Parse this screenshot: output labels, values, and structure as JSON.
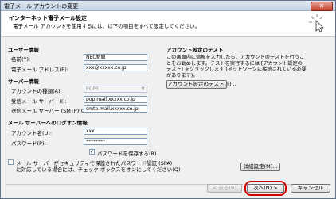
{
  "window": {
    "title": "電子メール アカウントの変更",
    "close_glyph": "✕"
  },
  "header": {
    "title": "インターネット電子メール設定",
    "subtitle": "電子メール アカウントを使用するには、以下の項目をすべて設定してください。"
  },
  "user_info": {
    "heading": "ユーザー情報",
    "name_label": "名前(Y):",
    "name_value": "NEC新聞",
    "email_label": "電子メール アドレス(E):",
    "email_value": "xxx@xxxxx.co.jp"
  },
  "server_info": {
    "heading": "サーバー情報",
    "account_type_label": "アカウントの種類(A):",
    "account_type_value": "POP3",
    "incoming_label": "受信メール サーバー(I):",
    "incoming_value": "pop.mail.xxxxx.co.jp",
    "outgoing_label": "送信メール サーバー (SMTP)(O):",
    "outgoing_value": "smtp.mail.xxxxx.co.jp"
  },
  "logon_info": {
    "heading": "メール サーバーへのログオン情報",
    "account_label": "アカウント名(U):",
    "account_value": "xxx",
    "password_label": "パスワード(P):",
    "password_value": "********",
    "remember_label": "パスワードを保存する(R)",
    "remember_checked": "✓",
    "spa_label_line1": "メール サーバーがセキュリティで保護されたパスワード認証 (SPA)",
    "spa_label_line2": "に対応している場合には、チェック ボックスをオンにしてください(Q)"
  },
  "test": {
    "heading": "アカウント設定のテスト",
    "paragraph": "この画面内に情報を入力したら、アカウントのテストを行うことをお勧めします。テストを実行するには [アカウント設定のテスト] をクリックします (ネットワークに接続されている必要があります)。",
    "test_button": "アカウント設定のテスト(T)...",
    "more_settings_button": "詳細設定(M)..."
  },
  "footer": {
    "back_button": "< 戻る(B)",
    "next_button": "次へ(N) >",
    "cancel_button": "キャンセル"
  },
  "colors": {
    "highlight": "#d00000",
    "accent": "#7f9db9"
  }
}
